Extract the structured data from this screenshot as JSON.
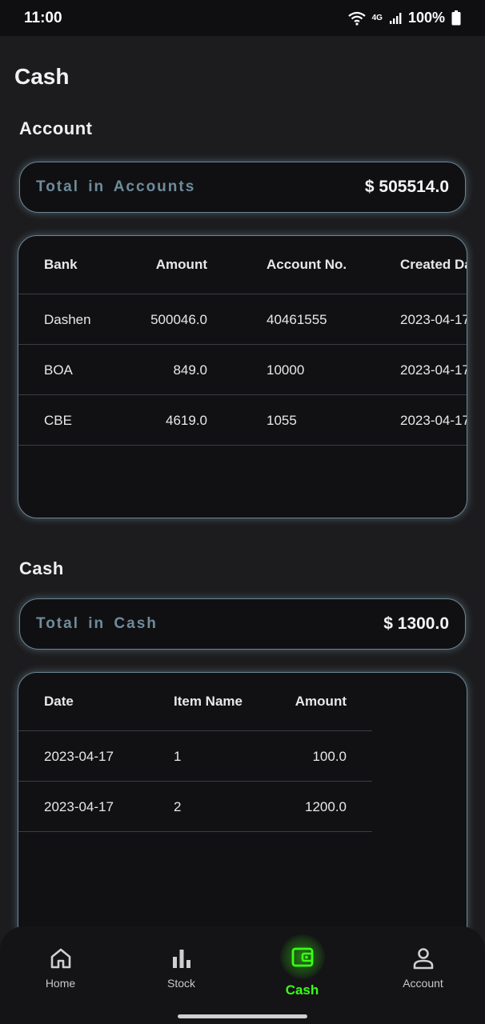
{
  "status_bar": {
    "time": "11:00",
    "network": "4G",
    "battery": "100%"
  },
  "page": {
    "title": "Cash"
  },
  "account_section": {
    "title": "Account",
    "total_label": "Total in Accounts",
    "total_value": "$ 505514.0",
    "columns": [
      "Bank",
      "Amount",
      "Account No.",
      "Created Da"
    ],
    "rows": [
      [
        "Dashen",
        "500046.0",
        "40461555",
        "2023-04-17"
      ],
      [
        "BOA",
        "849.0",
        "10000",
        "2023-04-17"
      ],
      [
        "CBE",
        "4619.0",
        "1055",
        "2023-04-17"
      ]
    ]
  },
  "cash_section": {
    "title": "Cash",
    "total_label": "Total in Cash",
    "total_value": "$ 1300.0",
    "columns": [
      "Date",
      "Item Name",
      "Amount"
    ],
    "rows": [
      [
        "2023-04-17",
        "1",
        "100.0"
      ],
      [
        "2023-04-17",
        "2",
        "1200.0"
      ]
    ]
  },
  "bottom_nav": {
    "items": [
      {
        "label": "Home",
        "icon": "home-icon"
      },
      {
        "label": "Stock",
        "icon": "bar-chart-icon"
      },
      {
        "label": "Cash",
        "icon": "wallet-icon",
        "active": true
      },
      {
        "label": "Account",
        "icon": "person-icon"
      }
    ],
    "active_color": "#39ff14"
  },
  "colors": {
    "accent_border": "#6b8593",
    "label_muted": "#6f8c9a",
    "background": "#1c1c1e"
  }
}
